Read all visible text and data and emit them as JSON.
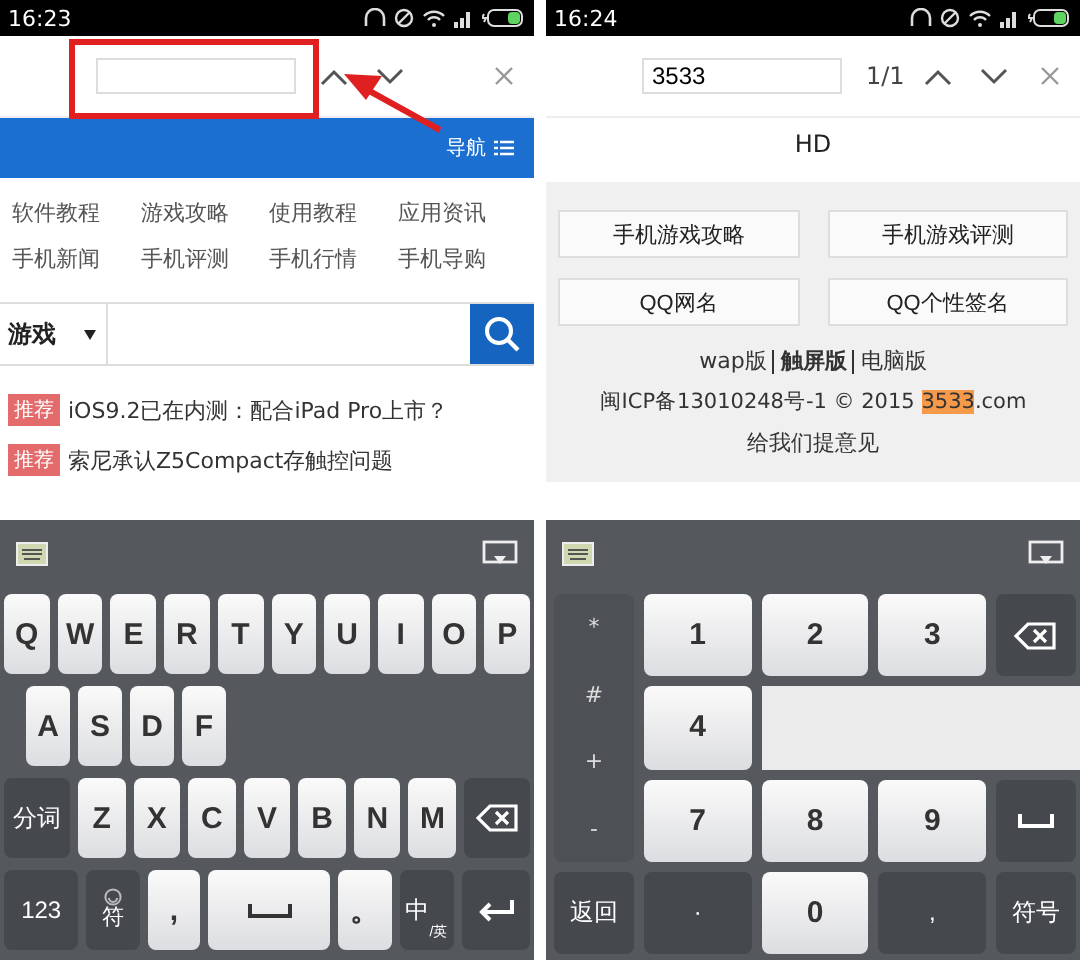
{
  "left_screen": {
    "status_bar": {
      "time": "16:23"
    },
    "nav_bar": {
      "label": "导航"
    },
    "categories": [
      "软件教程",
      "游戏攻略",
      "使用教程",
      "应用资讯",
      "手机新闻",
      "手机评测",
      "手机行情",
      "手机导购"
    ],
    "search": {
      "category": "游戏"
    },
    "news": [
      {
        "tag": "推荐",
        "title": "iOS9.2已在内测：配合iPad Pro上市？"
      },
      {
        "tag": "推荐",
        "title": "索尼承认Z5Compact存触控问题"
      }
    ],
    "keyboard": {
      "rows": [
        [
          {
            "label": "Q",
            "kind": "letter"
          },
          {
            "label": "W",
            "kind": "letter"
          },
          {
            "label": "E",
            "kind": "letter"
          },
          {
            "label": "R",
            "kind": "letter"
          },
          {
            "label": "T",
            "kind": "letter"
          },
          {
            "label": "Y",
            "kind": "letter"
          },
          {
            "label": "U",
            "kind": "letter"
          },
          {
            "label": "I",
            "kind": "letter"
          },
          {
            "label": "O",
            "kind": "letter"
          },
          {
            "label": "P",
            "kind": "letter"
          }
        ],
        [
          {
            "label": "A",
            "kind": "letter"
          },
          {
            "label": "S",
            "kind": "letter"
          },
          {
            "label": "D",
            "kind": "letter"
          },
          {
            "label": "F",
            "kind": "letter"
          }
        ],
        [
          {
            "label": "分词",
            "kind": "function"
          },
          {
            "label": "Z",
            "kind": "letter"
          },
          {
            "label": "X",
            "kind": "letter"
          },
          {
            "label": "C",
            "kind": "letter"
          },
          {
            "label": "V",
            "kind": "letter"
          },
          {
            "label": "B",
            "kind": "letter"
          },
          {
            "label": "N",
            "kind": "letter"
          },
          {
            "label": "M",
            "kind": "letter"
          },
          {
            "kind": "backspace"
          }
        ],
        [
          {
            "label": "123",
            "kind": "function"
          },
          {
            "label": "符",
            "kind": "emoji"
          },
          {
            "label": ",",
            "kind": "letter"
          },
          {
            "kind": "space"
          },
          {
            "label": "。",
            "kind": "letter"
          },
          {
            "label": "中",
            "sub": "/英",
            "kind": "language"
          },
          {
            "kind": "enter"
          }
        ]
      ]
    }
  },
  "right_screen": {
    "status_bar": {
      "time": "16:24"
    },
    "find_bar": {
      "value": "3533",
      "match_count": "1/1"
    },
    "page_text": "HD",
    "buttons": [
      "手机游戏攻略",
      "手机游戏评测",
      "QQ网名",
      "QQ个性签名"
    ],
    "versions": [
      {
        "label": "wap版",
        "selected": false
      },
      {
        "label": "触屏版",
        "selected": true
      },
      {
        "label": "电脑版",
        "selected": false
      }
    ],
    "icp": {
      "prefix": "闽ICP备13010248号-1 © 2015 ",
      "highlight": "3533",
      "suffix": ".com"
    },
    "feedback": "给我们提意见",
    "keypad": {
      "side_keys": [
        "*",
        "#",
        "+",
        "-"
      ],
      "rows": [
        [
          {
            "label": "1",
            "kind": "digit"
          },
          {
            "label": "2",
            "kind": "digit"
          },
          {
            "label": "3",
            "kind": "digit"
          },
          {
            "kind": "backspace"
          }
        ],
        [
          {
            "label": "4",
            "kind": "digit"
          }
        ],
        [
          {
            "label": "7",
            "kind": "digit"
          },
          {
            "label": "8",
            "kind": "digit"
          },
          {
            "label": "9",
            "kind": "digit"
          },
          {
            "kind": "space"
          }
        ]
      ],
      "bottom_row": [
        {
          "label": "返回",
          "kind": "function"
        },
        {
          "label": "·",
          "kind": "function"
        },
        {
          "label": "0",
          "kind": "digit"
        },
        {
          "label": ",",
          "kind": "function"
        },
        {
          "label": "符号",
          "kind": "function"
        }
      ]
    }
  }
}
